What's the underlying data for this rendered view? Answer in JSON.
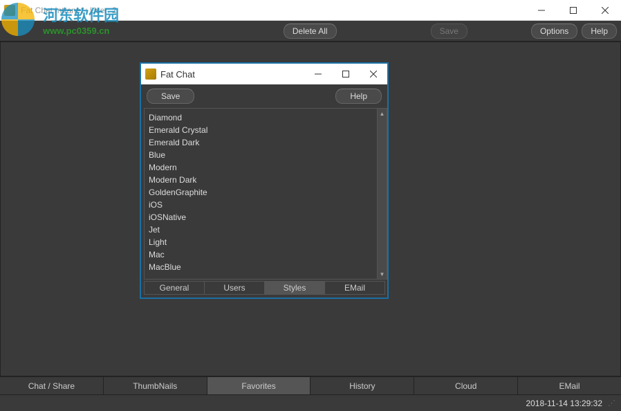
{
  "main_window": {
    "title": "Fat Chat Intranet : User: 2"
  },
  "watermark": {
    "text": "河东软件园",
    "url": "www.pc0359.cn"
  },
  "toolbar": {
    "delete_all": "Delete All",
    "save": "Save",
    "options": "Options",
    "help": "Help"
  },
  "bottom_tabs": [
    {
      "label": "Chat / Share",
      "active": false
    },
    {
      "label": "ThumbNails",
      "active": false
    },
    {
      "label": "Favorites",
      "active": true
    },
    {
      "label": "History",
      "active": false
    },
    {
      "label": "Cloud",
      "active": false
    },
    {
      "label": "EMail",
      "active": false
    }
  ],
  "statusbar": {
    "datetime": "2018-11-14 13:29:32"
  },
  "dialog": {
    "title": "Fat Chat",
    "toolbar": {
      "save": "Save",
      "help": "Help"
    },
    "styles": [
      "Diamond",
      "Emerald Crystal",
      "Emerald Dark",
      "Blue",
      "Modern",
      "Modern Dark",
      "GoldenGraphite",
      "iOS",
      "iOSNative",
      "Jet",
      "Light",
      "Mac",
      "MacBlue"
    ],
    "tabs": [
      {
        "label": "General",
        "active": false
      },
      {
        "label": "Users",
        "active": false
      },
      {
        "label": "Styles",
        "active": true
      },
      {
        "label": "EMail",
        "active": false
      }
    ]
  }
}
